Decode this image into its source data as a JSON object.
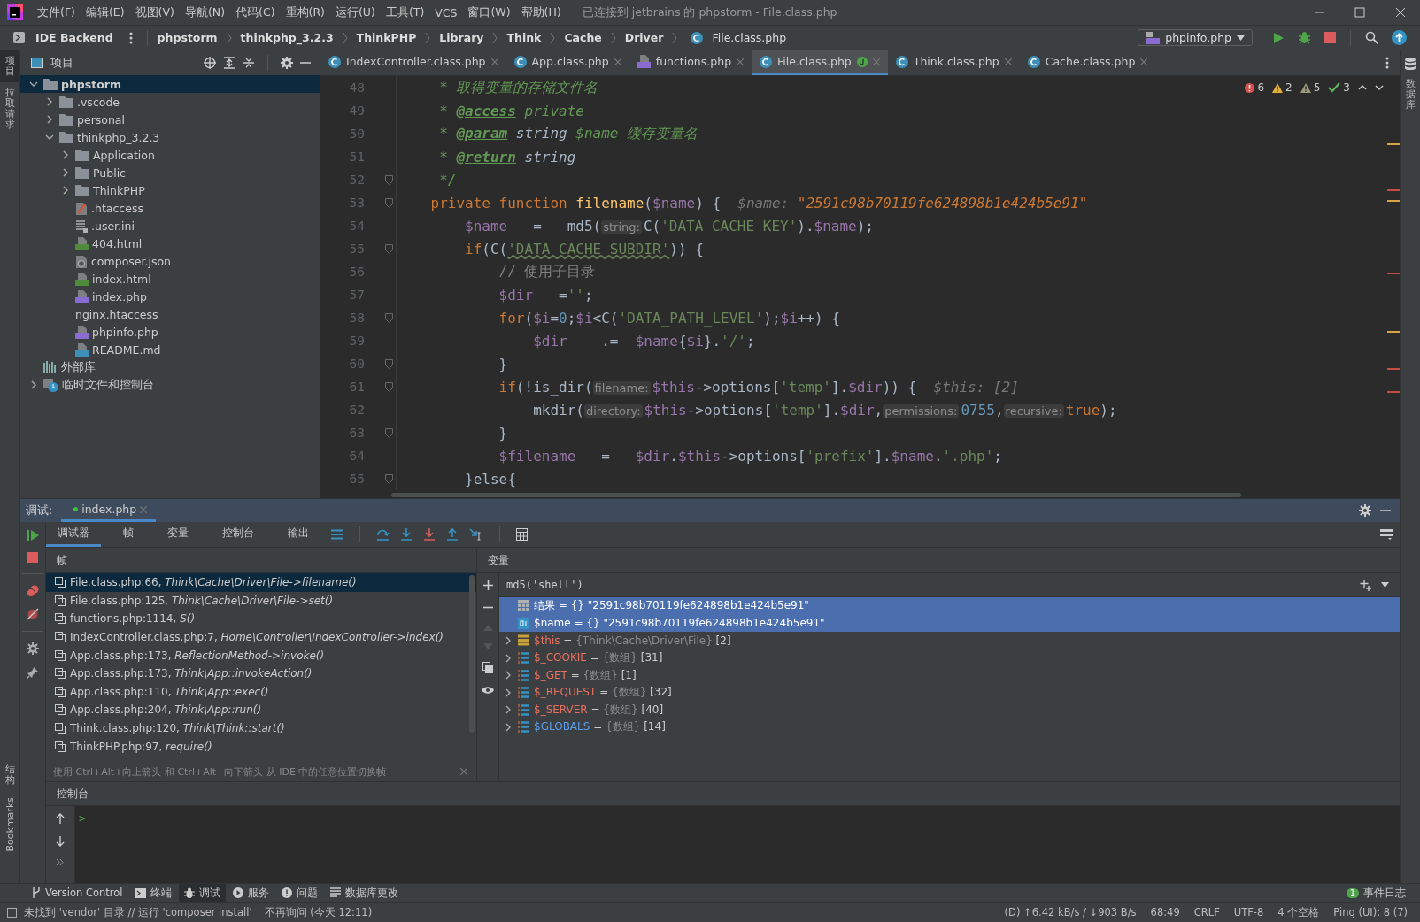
{
  "window": {
    "title": "已连接到 jetbrains 的 phpstorm - File.class.php"
  },
  "menu": [
    "文件(F)",
    "编辑(E)",
    "视图(V)",
    "导航(N)",
    "代码(C)",
    "重构(R)",
    "运行(U)",
    "工具(T)",
    "VCS",
    "窗口(W)",
    "帮助(H)"
  ],
  "navbar": {
    "backend": "IDE Backend",
    "breadcrumbs": [
      {
        "label": "phpstorm",
        "kind": "folder"
      },
      {
        "label": "thinkphp_3.2.3",
        "kind": "folder"
      },
      {
        "label": "ThinkPHP",
        "kind": "folder"
      },
      {
        "label": "Library",
        "kind": "folder"
      },
      {
        "label": "Think",
        "kind": "folder"
      },
      {
        "label": "Cache",
        "kind": "folder"
      },
      {
        "label": "Driver",
        "kind": "folder"
      },
      {
        "label": "File.class.php",
        "kind": "class"
      }
    ],
    "run_config": "phpinfo.php"
  },
  "left_stripe": [
    {
      "label": "项目",
      "selected": true
    },
    {
      "label": "拉取请求",
      "selected": false
    }
  ],
  "left_stripe_bottom": [
    {
      "label": "结构",
      "kind": "cjk"
    },
    {
      "label": "Bookmarks",
      "kind": "latin"
    }
  ],
  "right_stripe": [
    "数据库"
  ],
  "project": {
    "title": "项目",
    "tree": [
      {
        "name": "phpstorm",
        "kind": "folder",
        "expanded": true,
        "selected": true,
        "children": [
          {
            "name": ".vscode",
            "kind": "folder",
            "expanded": false,
            "selected": false
          },
          {
            "name": "personal",
            "kind": "folder",
            "expanded": false,
            "selected": false
          },
          {
            "name": "thinkphp_3.2.3",
            "kind": "folder",
            "expanded": true,
            "selected": false,
            "children": [
              {
                "name": "Application",
                "kind": "folder",
                "expanded": false,
                "selected": false
              },
              {
                "name": "Public",
                "kind": "folder",
                "expanded": false,
                "selected": false
              },
              {
                "name": "ThinkPHP",
                "kind": "folder",
                "expanded": false,
                "selected": false
              },
              {
                "name": ".htaccess",
                "kind": "htaccess",
                "selected": false
              },
              {
                "name": ".user.ini",
                "kind": "ini",
                "selected": false
              },
              {
                "name": "404.html",
                "kind": "html",
                "selected": false
              },
              {
                "name": "composer.json",
                "kind": "json",
                "selected": false
              },
              {
                "name": "index.html",
                "kind": "html",
                "selected": false
              },
              {
                "name": "index.php",
                "kind": "php",
                "selected": false
              },
              {
                "name": "nginx.htaccess",
                "kind": "plain",
                "selected": false
              },
              {
                "name": "phpinfo.php",
                "kind": "php",
                "selected": false
              },
              {
                "name": "README.md",
                "kind": "md",
                "selected": false
              }
            ]
          }
        ]
      },
      {
        "name": "外部库",
        "kind": "library",
        "selected": false
      },
      {
        "name": "临时文件和控制台",
        "kind": "scratch",
        "expanded": false,
        "selected": false
      }
    ]
  },
  "editor": {
    "tabs": [
      {
        "label": "IndexController.class.php",
        "kind": "class",
        "selected": false
      },
      {
        "label": "App.class.php",
        "kind": "class",
        "selected": false
      },
      {
        "label": "functions.php",
        "kind": "php",
        "selected": false
      },
      {
        "label": "File.class.php",
        "kind": "class",
        "selected": true,
        "vcs_badge": true
      },
      {
        "label": "Think.class.php",
        "kind": "class",
        "selected": false
      },
      {
        "label": "Cache.class.php",
        "kind": "class",
        "selected": false
      }
    ],
    "inspections": [
      {
        "kind": "error",
        "count": "6"
      },
      {
        "kind": "warning",
        "count": "2"
      },
      {
        "kind": "weak",
        "count": "5"
      },
      {
        "kind": "ok",
        "count": "3"
      }
    ],
    "lines": [
      {
        "no": "48",
        "fold": false,
        "tokens": [
          {
            "kind": "comment",
            "text": "     * 取得变量的存储文件名"
          }
        ]
      },
      {
        "no": "49",
        "fold": false,
        "tokens": [
          {
            "kind": "comment",
            "text": "     * "
          },
          {
            "kind": "tag",
            "text": "@access"
          },
          {
            "kind": "comment",
            "text": " private"
          }
        ]
      },
      {
        "no": "50",
        "fold": false,
        "tokens": [
          {
            "kind": "comment",
            "text": "     * "
          },
          {
            "kind": "tag",
            "text": "@param"
          },
          {
            "kind": "doctype",
            "text": " string "
          },
          {
            "kind": "comment",
            "text": "$name 缓存变量名"
          }
        ]
      },
      {
        "no": "51",
        "fold": false,
        "tokens": [
          {
            "kind": "comment",
            "text": "     * "
          },
          {
            "kind": "tag",
            "text": "@return"
          },
          {
            "kind": "doctype",
            "text": " string"
          }
        ]
      },
      {
        "no": "52",
        "fold": true,
        "tokens": [
          {
            "kind": "comment",
            "text": "     */"
          }
        ]
      },
      {
        "no": "53",
        "fold": true,
        "tokens": [
          {
            "kind": "keyword",
            "text": "    private function "
          },
          {
            "kind": "function",
            "text": "filename"
          },
          {
            "kind": "plain",
            "text": "("
          },
          {
            "kind": "var",
            "text": "$name"
          },
          {
            "kind": "plain",
            "text": ") {  "
          },
          {
            "kind": "inline",
            "text": "$name: "
          },
          {
            "kind": "inline-string",
            "text": "\"2591c98b70119fe624898b1e424b5e91\""
          }
        ]
      },
      {
        "no": "54",
        "fold": false,
        "tokens": [
          {
            "kind": "var",
            "text": "        $name"
          },
          {
            "kind": "plain",
            "text": "   =   md5("
          },
          {
            "kind": "hint",
            "text": "string:"
          },
          {
            "kind": "plain",
            "text": "C("
          },
          {
            "kind": "string",
            "text": "'DATA_CACHE_KEY'"
          },
          {
            "kind": "plain",
            "text": ")."
          },
          {
            "kind": "var",
            "text": "$name"
          },
          {
            "kind": "plain",
            "text": ");"
          }
        ]
      },
      {
        "no": "55",
        "fold": true,
        "tokens": [
          {
            "kind": "keyword",
            "text": "        if"
          },
          {
            "kind": "plain",
            "text": "(C("
          },
          {
            "kind": "typo-string",
            "text": "'DATA_CACHE_SUBDIR'"
          },
          {
            "kind": "plain",
            "text": ")) {"
          }
        ]
      },
      {
        "no": "56",
        "fold": false,
        "tokens": [
          {
            "kind": "line-comment",
            "text": "            // 使用子目录"
          }
        ]
      },
      {
        "no": "57",
        "fold": false,
        "tokens": [
          {
            "kind": "var",
            "text": "            $dir"
          },
          {
            "kind": "plain",
            "text": "   ="
          },
          {
            "kind": "string",
            "text": "''"
          },
          {
            "kind": "plain",
            "text": ";"
          }
        ]
      },
      {
        "no": "58",
        "fold": true,
        "tokens": [
          {
            "kind": "keyword",
            "text": "            for"
          },
          {
            "kind": "plain",
            "text": "("
          },
          {
            "kind": "var",
            "text": "$i"
          },
          {
            "kind": "plain",
            "text": "="
          },
          {
            "kind": "number",
            "text": "0"
          },
          {
            "kind": "plain",
            "text": ";"
          },
          {
            "kind": "var",
            "text": "$i"
          },
          {
            "kind": "plain",
            "text": "<C("
          },
          {
            "kind": "string",
            "text": "'DATA_PATH_LEVEL'"
          },
          {
            "kind": "plain",
            "text": ");"
          },
          {
            "kind": "var",
            "text": "$i"
          },
          {
            "kind": "plain",
            "text": "++) {"
          }
        ]
      },
      {
        "no": "59",
        "fold": false,
        "tokens": [
          {
            "kind": "var",
            "text": "                $dir"
          },
          {
            "kind": "plain",
            "text": "    .=  "
          },
          {
            "kind": "var",
            "text": "$name"
          },
          {
            "kind": "plain",
            "text": "{"
          },
          {
            "kind": "var",
            "text": "$i"
          },
          {
            "kind": "plain",
            "text": "}."
          },
          {
            "kind": "string",
            "text": "'/'"
          },
          {
            "kind": "plain",
            "text": ";"
          }
        ]
      },
      {
        "no": "60",
        "fold": true,
        "tokens": [
          {
            "kind": "plain",
            "text": "            }"
          }
        ]
      },
      {
        "no": "61",
        "fold": true,
        "tokens": [
          {
            "kind": "keyword",
            "text": "            if"
          },
          {
            "kind": "plain",
            "text": "(!is_dir("
          },
          {
            "kind": "hint",
            "text": "filename:"
          },
          {
            "kind": "var",
            "text": "$this"
          },
          {
            "kind": "plain",
            "text": "->options["
          },
          {
            "kind": "string",
            "text": "'temp'"
          },
          {
            "kind": "plain",
            "text": "]."
          },
          {
            "kind": "var",
            "text": "$dir"
          },
          {
            "kind": "plain",
            "text": ")) {  "
          },
          {
            "kind": "inline",
            "text": "$this: [2]"
          }
        ]
      },
      {
        "no": "62",
        "fold": false,
        "tokens": [
          {
            "kind": "plain",
            "text": "                mkdir("
          },
          {
            "kind": "hint",
            "text": "directory:"
          },
          {
            "kind": "var",
            "text": "$this"
          },
          {
            "kind": "plain",
            "text": "->options["
          },
          {
            "kind": "string",
            "text": "'temp'"
          },
          {
            "kind": "plain",
            "text": "]."
          },
          {
            "kind": "var",
            "text": "$dir"
          },
          {
            "kind": "plain",
            "text": ","
          },
          {
            "kind": "hint",
            "text": "permissions:"
          },
          {
            "kind": "number",
            "text": "0755"
          },
          {
            "kind": "plain",
            "text": ","
          },
          {
            "kind": "hint",
            "text": "recursive:"
          },
          {
            "kind": "keyword",
            "text": "true"
          },
          {
            "kind": "plain",
            "text": ");"
          }
        ]
      },
      {
        "no": "63",
        "fold": true,
        "tokens": [
          {
            "kind": "plain",
            "text": "            }"
          }
        ]
      },
      {
        "no": "64",
        "fold": false,
        "tokens": [
          {
            "kind": "var",
            "text": "            $filename"
          },
          {
            "kind": "plain",
            "text": "   =   "
          },
          {
            "kind": "var",
            "text": "$dir"
          },
          {
            "kind": "plain",
            "text": "."
          },
          {
            "kind": "var",
            "text": "$this"
          },
          {
            "kind": "plain",
            "text": "->options["
          },
          {
            "kind": "string",
            "text": "'prefix'"
          },
          {
            "kind": "plain",
            "text": "]."
          },
          {
            "kind": "var",
            "text": "$name"
          },
          {
            "kind": "plain",
            "text": "."
          },
          {
            "kind": "string",
            "text": "'.php'"
          },
          {
            "kind": "plain",
            "text": ";"
          }
        ]
      },
      {
        "no": "65",
        "fold": true,
        "tokens": [
          {
            "kind": "plain",
            "text": "        }else{"
          }
        ]
      }
    ]
  },
  "debug": {
    "label": "调试:",
    "session": "index.php",
    "tabs": [
      {
        "label": "调试器",
        "selected": true
      },
      {
        "label": "帧",
        "selected": false
      },
      {
        "label": "变量",
        "selected": false
      },
      {
        "label": "控制台",
        "selected": false
      },
      {
        "label": "输出",
        "selected": false
      }
    ],
    "frames_title": "帧",
    "frames": [
      {
        "text": "File.class.php:66, *Think\\Cache\\Driver\\File->filename()*",
        "selected": true
      },
      {
        "text": "File.class.php:125, *Think\\Cache\\Driver\\File->set()*",
        "selected": false
      },
      {
        "text": "functions.php:1114, *S()*",
        "selected": false
      },
      {
        "text": "IndexController.class.php:7, *Home\\Controller\\IndexController->index()*",
        "selected": false
      },
      {
        "text": "App.class.php:173, *ReflectionMethod->invoke()*",
        "selected": false
      },
      {
        "text": "App.class.php:173, *Think\\App::invokeAction()*",
        "selected": false
      },
      {
        "text": "App.class.php:110, *Think\\App::exec()*",
        "selected": false
      },
      {
        "text": "App.class.php:204, *Think\\App::run()*",
        "selected": false
      },
      {
        "text": "Think.class.php:120, *Think\\Think::start()*",
        "selected": false
      },
      {
        "text": "ThinkPHP.php:97, *require()*",
        "selected": false
      }
    ],
    "frames_hint": "使用 Ctrl+Alt+向上箭头 和 Ctrl+Alt+向下箭头 从 IDE 中的任意位置切换帧",
    "variables_title": "变量",
    "watch_expression": "md5('shell')",
    "variables": [
      {
        "kind": "result",
        "name": "结果",
        "operator": "=",
        "type": "{}",
        "value": "\"2591c98b70119fe624898b1e424b5e91\"",
        "selected": true
      },
      {
        "kind": "string",
        "name": "$name",
        "operator": "=",
        "type": "{}",
        "value": "\"2591c98b70119fe624898b1e424b5e91\"",
        "selected": true
      },
      {
        "kind": "object",
        "name": "$this",
        "operator": "=",
        "type": "{Think\\Cache\\Driver\\File}",
        "value": "[2]",
        "selected": false,
        "expanded": false,
        "color": "#e8705e"
      },
      {
        "kind": "array",
        "name": "$_COOKIE",
        "operator": "=",
        "type": "{数组}",
        "value": "[31]",
        "selected": false,
        "expanded": false,
        "color": "#e8705e"
      },
      {
        "kind": "array",
        "name": "$_GET",
        "operator": "=",
        "type": "{数组}",
        "value": "[1]",
        "selected": false,
        "expanded": false,
        "color": "#e8705e"
      },
      {
        "kind": "array",
        "name": "$_REQUEST",
        "operator": "=",
        "type": "{数组}",
        "value": "[32]",
        "selected": false,
        "expanded": false,
        "color": "#e8705e"
      },
      {
        "kind": "array",
        "name": "$_SERVER",
        "operator": "=",
        "type": "{数组}",
        "value": "[40]",
        "selected": false,
        "expanded": false,
        "color": "#e8705e"
      },
      {
        "kind": "array",
        "name": "$GLOBALS",
        "operator": "=",
        "type": "{数组}",
        "value": "[14]",
        "selected": false,
        "expanded": false,
        "color": "#5c9ded"
      }
    ],
    "console_title": "控制台",
    "prompt": ">"
  },
  "tool_tabs": [
    {
      "label": "Version Control",
      "kind": "vcs",
      "selected": false
    },
    {
      "label": "终端",
      "kind": "terminal",
      "selected": false
    },
    {
      "label": "调试",
      "kind": "debug",
      "selected": true
    },
    {
      "label": "服务",
      "kind": "services",
      "selected": false
    },
    {
      "label": "问题",
      "kind": "problems",
      "selected": false
    },
    {
      "label": "数据库更改",
      "kind": "database",
      "selected": false
    }
  ],
  "event_log": {
    "badge": "1",
    "label": "事件日志"
  },
  "status_bar": {
    "message": "未找到 'vendor' 目录 // 运行 'composer install'",
    "dismiss": "不再询问 (今天 12:11)",
    "items": [
      "(D) ↑6.42 kB/s / ↓903 B/s",
      "68:49",
      "CRLF",
      "UTF-8",
      "4 个空格",
      "Ping (UI): 8 (7)"
    ]
  }
}
